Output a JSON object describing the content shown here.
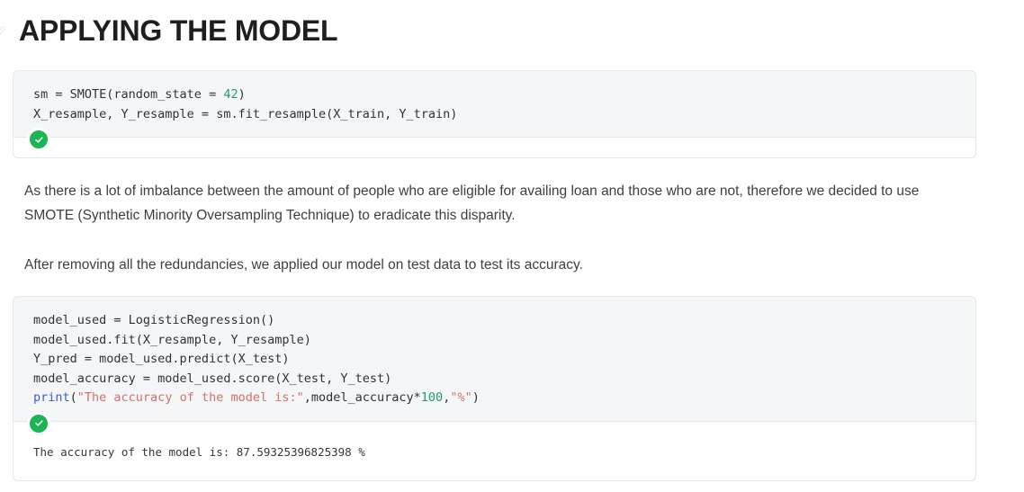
{
  "page": {
    "title": "APPLYING THE MODEL",
    "anchor_icon": "link-anchor-icon"
  },
  "colors": {
    "heading": "#1f1f1f",
    "code_background": "#f5f6f7",
    "code_border": "#e6e8ea",
    "output_background": "#ffffff",
    "status_green": "#1cb554",
    "token_number": "#1f9d6e",
    "token_string": "#d4716b",
    "token_keyword": "#3b5bdb",
    "body_text": "#3c4043"
  },
  "cells": [
    {
      "id": "smote-cell",
      "status": "success",
      "status_icon": "check-circle-icon",
      "code_lines": [
        {
          "tokens": [
            {
              "text": "sm = SMOTE(random_state = ",
              "type": "plain"
            },
            {
              "text": "42",
              "type": "number"
            },
            {
              "text": ")",
              "type": "plain"
            }
          ]
        },
        {
          "tokens": [
            {
              "text": "X_resample, Y_resample = sm.fit_resample(X_train, Y_train)",
              "type": "plain"
            }
          ]
        }
      ],
      "output": ""
    },
    {
      "id": "model-cell",
      "status": "success",
      "status_icon": "check-circle-icon",
      "code_lines": [
        {
          "tokens": [
            {
              "text": "model_used = LogisticRegression()",
              "type": "plain"
            }
          ]
        },
        {
          "tokens": [
            {
              "text": "model_used.fit(X_resample, Y_resample)",
              "type": "plain"
            }
          ]
        },
        {
          "tokens": [
            {
              "text": "Y_pred = model_used.predict(X_test)",
              "type": "plain"
            }
          ]
        },
        {
          "tokens": [
            {
              "text": "model_accuracy = model_used.score(X_test, Y_test)",
              "type": "plain"
            }
          ]
        },
        {
          "tokens": [
            {
              "text": "print",
              "type": "keyword"
            },
            {
              "text": "(",
              "type": "plain"
            },
            {
              "text": "\"The accuracy of the model is:\"",
              "type": "string"
            },
            {
              "text": ",model_accuracy*",
              "type": "plain"
            },
            {
              "text": "100",
              "type": "number"
            },
            {
              "text": ",",
              "type": "plain"
            },
            {
              "text": "\"%\"",
              "type": "string"
            },
            {
              "text": ")",
              "type": "plain"
            }
          ]
        }
      ],
      "output": "The accuracy of the model is: 87.59325396825398 %"
    }
  ],
  "paragraphs": [
    {
      "id": "smote-explanation",
      "text": "As there is a lot of imbalance between the amount of people who are eligible for availing loan and those who are not, therefore we decided to use SMOTE (Synthetic Minority Oversampling Technique) to eradicate this disparity."
    },
    {
      "id": "accuracy-intro",
      "text": "After removing all the redundancies, we applied our model on test data to test its accuracy."
    }
  ]
}
